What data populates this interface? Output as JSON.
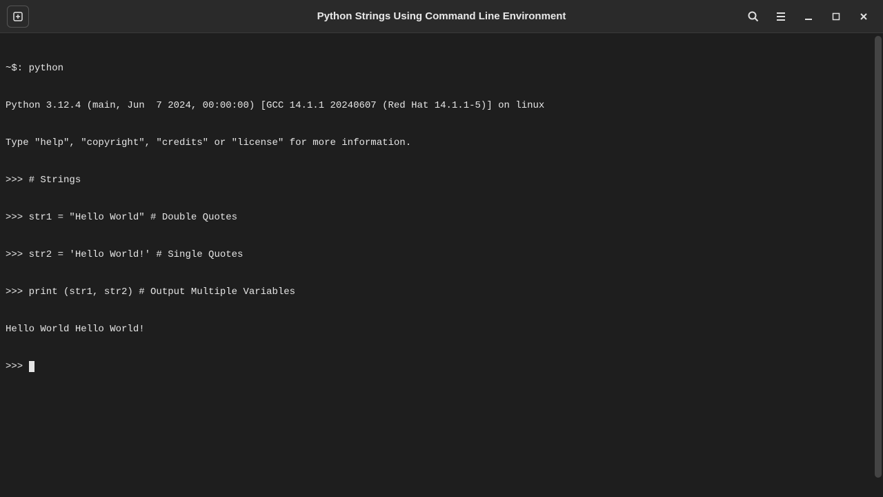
{
  "titlebar": {
    "title": "Python Strings Using Command Line Environment"
  },
  "terminal": {
    "lines": [
      "~$: python",
      "Python 3.12.4 (main, Jun  7 2024, 00:00:00) [GCC 14.1.1 20240607 (Red Hat 14.1.1-5)] on linux",
      "Type \"help\", \"copyright\", \"credits\" or \"license\" for more information.",
      ">>> # Strings",
      ">>> str1 = \"Hello World\" # Double Quotes",
      ">>> str2 = 'Hello World!' # Single Quotes",
      ">>> print (str1, str2) # Output Multiple Variables",
      "Hello World Hello World!",
      ">>> "
    ]
  }
}
